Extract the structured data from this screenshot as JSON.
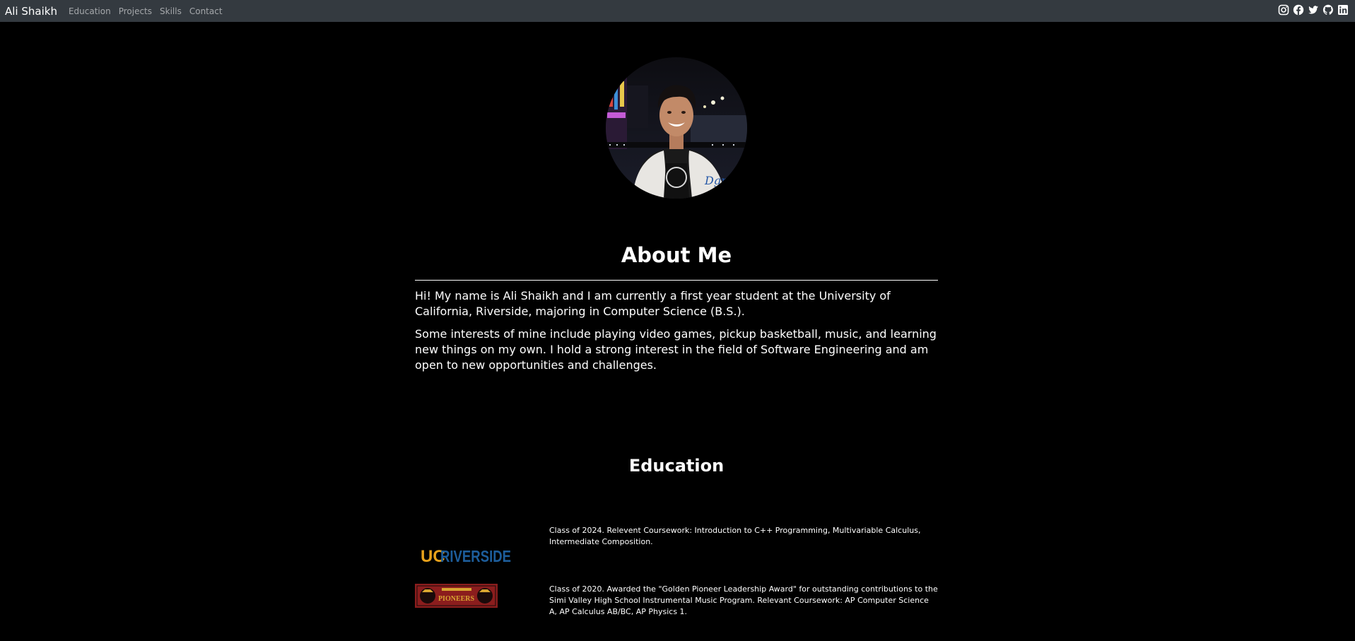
{
  "navbar": {
    "brand": "Ali Shaikh",
    "links": [
      "Education",
      "Projects",
      "Skills",
      "Contact"
    ],
    "social_icons": [
      "instagram-icon",
      "facebook-icon",
      "twitter-icon",
      "github-icon",
      "linkedin-icon"
    ]
  },
  "about": {
    "title": "About Me",
    "paragraphs": [
      "Hi! My name is Ali Shaikh and I am currently a first year student at the University of California, Riverside, majoring in Computer Science (B.S.).",
      "Some interests of mine include playing video games, pickup basketball, music, and learning new things on my own. I hold a strong interest in the field of Software Engineering and am open to new opportunities and challenges."
    ]
  },
  "education": {
    "title": "Education",
    "entries": [
      {
        "logo_uc": "UC",
        "logo_name": "RIVERSIDE",
        "text": "Class of 2024. Relevent Coursework: Introduction to C++ Programming, Multivariable Calculus, Intermediate Composition."
      },
      {
        "logo_name": "PIONEERS",
        "text": "Class of 2020. Awarded the \"Golden Pioneer Leadership Award\" for outstanding contributions to the Simi Valley High School Instrumental Music Program. Relevant Coursework: AP Computer Science A, AP Calculus AB/BC, AP Physics 1."
      }
    ]
  },
  "colors": {
    "background": "#000000",
    "navbar": "#343a40",
    "ucr_gold": "#e8a21b",
    "ucr_blue": "#1d5d9b",
    "svh_red": "#8b1d1d"
  }
}
